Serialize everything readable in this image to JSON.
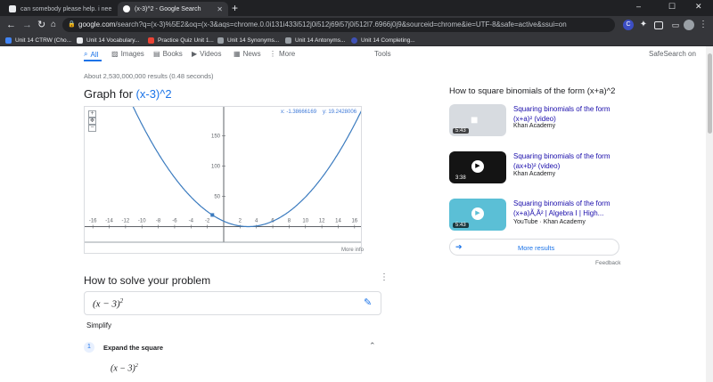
{
  "browser": {
    "tabs": [
      {
        "title": "can somebody please help. i nee"
      },
      {
        "title": "(x-3)^2 - Google Search"
      }
    ],
    "new_tab": "+",
    "window_controls": {
      "minimize": "–",
      "maximize": "☐",
      "close": "✕"
    },
    "url_host": "google.com",
    "url_path": "/search?q=(x-3)%5E2&oq=(x-3&aqs=chrome.0.0i131i433i512j0i512j69i57j0i512l7.6966j0j9&sourceid=chrome&ie=UTF-8&safe=active&ssui=on",
    "bookmarks": [
      {
        "label": "Unit 14 CTRW (Cho...",
        "color": "#4285f4"
      },
      {
        "label": "Unit 14 Vocabulary...",
        "color": "#e8eaed"
      },
      {
        "label": "Practice Quiz Unit 1...",
        "color": "#ea4335"
      },
      {
        "label": "Unit 14 Synonyms...",
        "color": "#9aa0a6"
      },
      {
        "label": "Unit 14 Antonyms...",
        "color": "#9aa0a6"
      },
      {
        "label": "Unit 14 Completing...",
        "color": "#3f51b5"
      }
    ],
    "ext_badge": "C"
  },
  "search_tabs": {
    "all": "All",
    "images": "Images",
    "books": "Books",
    "videos": "Videos",
    "news": "News",
    "more": "More",
    "tools": "Tools",
    "safesearch": "SafeSearch on"
  },
  "results_stats": "About 2,530,000,000 results (0.48 seconds)",
  "graph": {
    "title_prefix": "Graph for ",
    "query": "(x-3)^2",
    "coord_x": "x: -1.38666169",
    "coord_y": "y: 19.2428006",
    "more_info": "More info",
    "zoom_in": "+",
    "zoom_out": "−"
  },
  "chart_data": {
    "type": "line",
    "function": "(x-3)^2",
    "x_ticks": [
      "-16",
      "-14",
      "-12",
      "-10",
      "-8",
      "-6",
      "-4",
      "-2",
      "2",
      "4",
      "6",
      "8",
      "10",
      "12",
      "14",
      "16"
    ],
    "y_ticks": [
      "50",
      "100",
      "150"
    ],
    "xlim": [
      -17,
      17
    ],
    "ylim": [
      -14,
      198
    ],
    "highlight_point": {
      "x": -1.38666169,
      "y": 19.2428006
    },
    "accent": "#3b7bbf"
  },
  "related": {
    "title": "How to square binomials of the form (x+a)^2",
    "videos": [
      {
        "title": "Squaring binomials of the form (x+a)² (video)",
        "source": "Khan Academy",
        "duration": "5:43",
        "thumb": "#d7dbe0"
      },
      {
        "title": "Squaring binomials of the form (ax+b)² (video)",
        "source": "Khan Academy",
        "duration": "3:38",
        "thumb": "#141414"
      },
      {
        "title": "Squaring binomials of the form (x+a)Ã‚Â² | Algebra I | High...",
        "source": "YouTube · Khan Academy",
        "duration": "5:43",
        "thumb": "#5bbfd6"
      }
    ],
    "more_results": "More results",
    "feedback": "Feedback"
  },
  "solve": {
    "title": "How to solve your problem",
    "expression": "(x − 3)",
    "exponent": "2",
    "simplify": "Simplify",
    "step_number": "1",
    "step_label": "Expand the square",
    "step_expression": "(x − 3)",
    "step_exponent": "2"
  }
}
